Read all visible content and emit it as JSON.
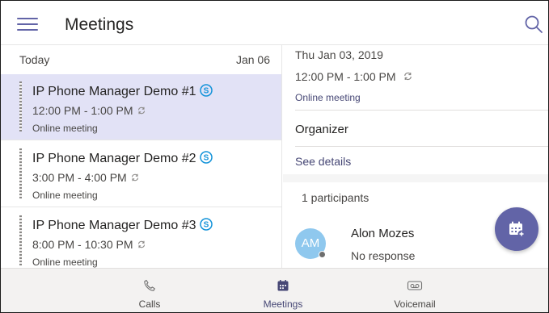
{
  "header": {
    "title": "Meetings"
  },
  "list": {
    "day_label": "Today",
    "day_date": "Jan 06",
    "items": [
      {
        "name": "IP Phone Manager Demo #1",
        "time": "12:00 PM - 1:00 PM",
        "kind": "Online meeting",
        "selected": true
      },
      {
        "name": "IP Phone Manager Demo #2",
        "time": "3:00 PM - 4:00 PM",
        "kind": "Online meeting",
        "selected": false
      },
      {
        "name": "IP Phone Manager Demo #3",
        "time": "8:00 PM - 10:30 PM",
        "kind": "Online meeting",
        "selected": false
      }
    ]
  },
  "details": {
    "date": "Thu Jan 03, 2019",
    "time": "12:00 PM - 1:00 PM",
    "kind": "Online meeting",
    "organizer_label": "Organizer",
    "see_details": "See details",
    "participants_count": "1 participants",
    "participant": {
      "initials": "AM",
      "name": "Alon Mozes",
      "status": "No response"
    }
  },
  "nav": {
    "calls": "Calls",
    "meetings": "Meetings",
    "voicemail": "Voicemail",
    "active": "meetings"
  },
  "colors": {
    "accent": "#6264a7",
    "selected_bg": "#e2e2f6",
    "avatar": "#8fc8ee",
    "skype": "#1192d9"
  },
  "icons": [
    "menu-icon",
    "search-icon",
    "skype-icon",
    "recurring-icon",
    "new-meeting-icon",
    "phone-icon",
    "calendar-icon",
    "voicemail-icon"
  ]
}
